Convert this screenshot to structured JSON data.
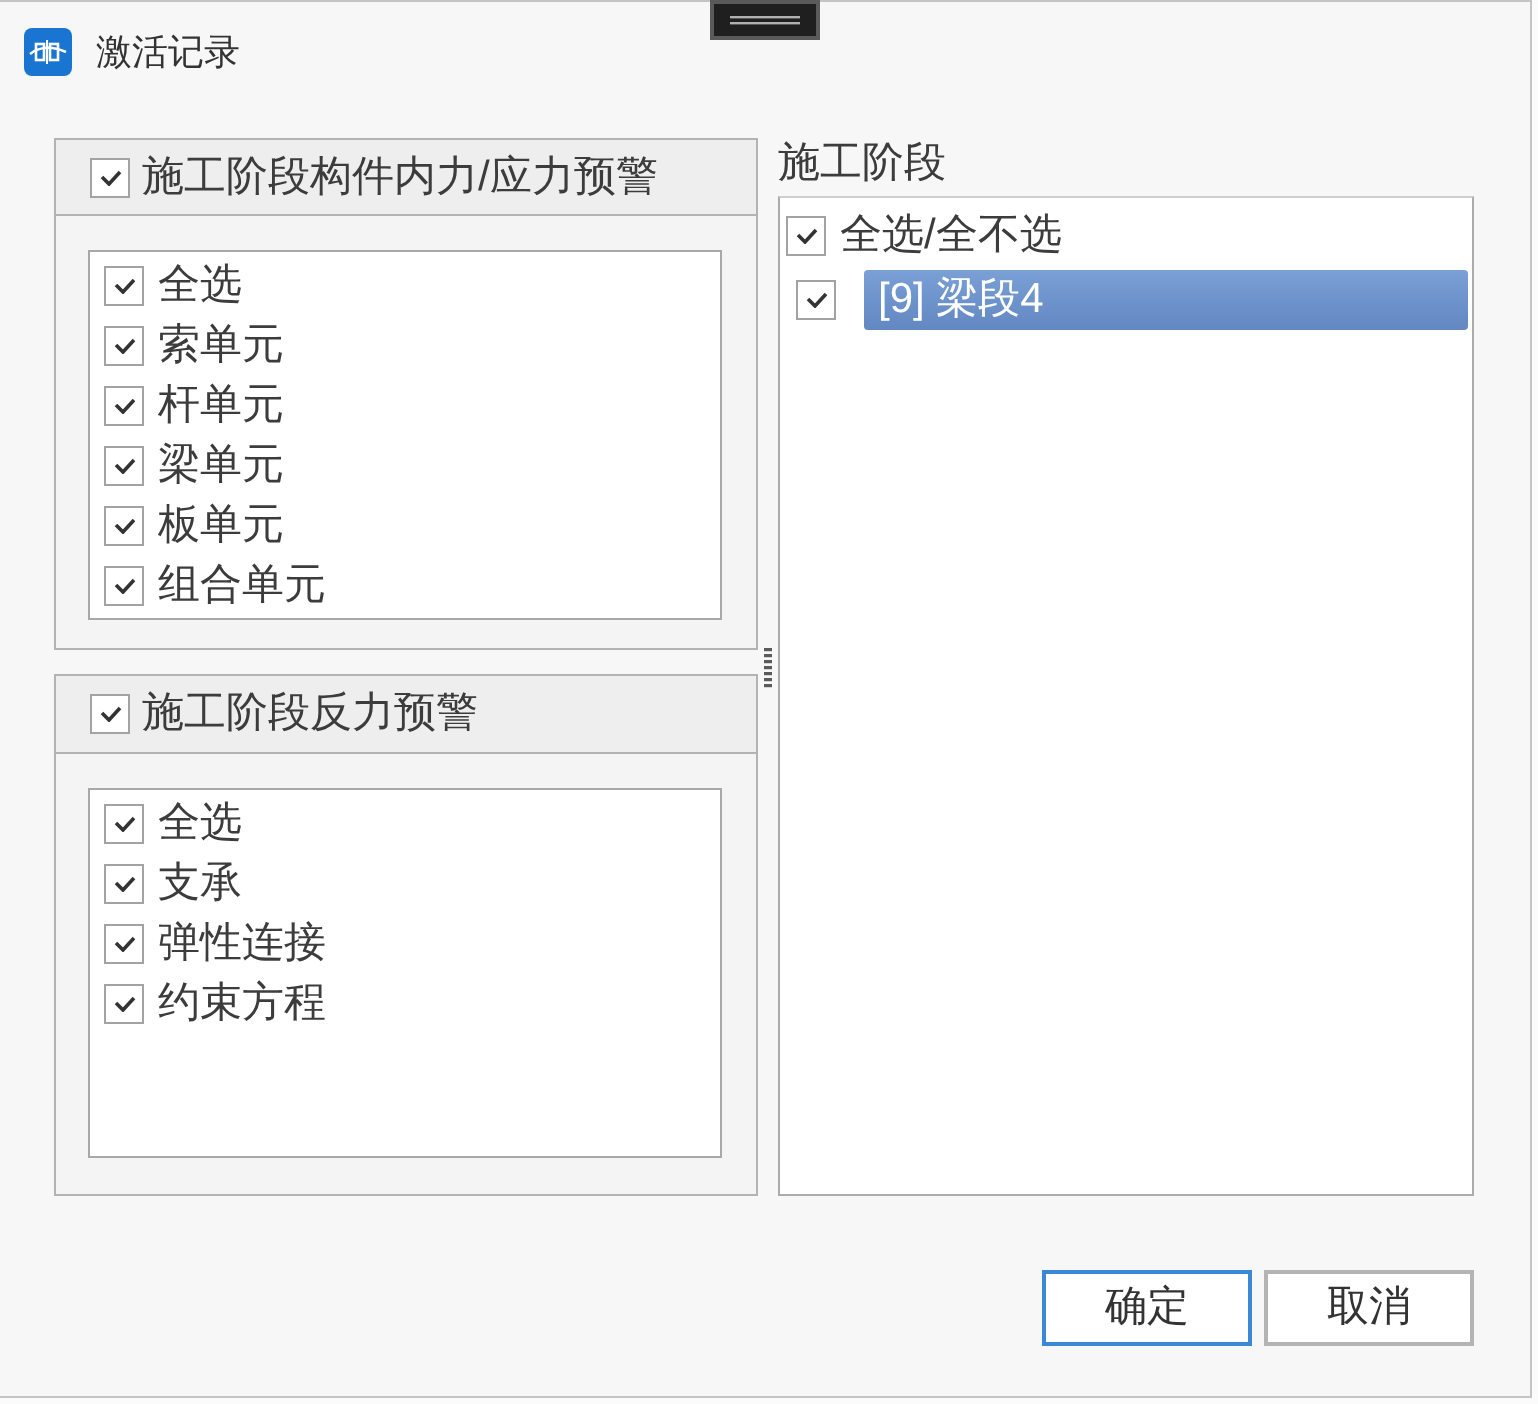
{
  "window": {
    "title": "激活记录"
  },
  "warning_groups": [
    {
      "title": "施工阶段构件内力/应力预警",
      "checked": true,
      "items": [
        {
          "label": "全选",
          "checked": true
        },
        {
          "label": "索单元",
          "checked": true
        },
        {
          "label": "杆单元",
          "checked": true
        },
        {
          "label": "梁单元",
          "checked": true
        },
        {
          "label": "板单元",
          "checked": true
        },
        {
          "label": "组合单元",
          "checked": true
        }
      ]
    },
    {
      "title": "施工阶段反力预警",
      "checked": true,
      "items": [
        {
          "label": "全选",
          "checked": true
        },
        {
          "label": "支承",
          "checked": true
        },
        {
          "label": "弹性连接",
          "checked": true
        },
        {
          "label": "约束方程",
          "checked": true
        }
      ]
    }
  ],
  "stage_panel": {
    "label": "施工阶段",
    "tree": [
      {
        "label": "全选/全不选",
        "checked": true,
        "selected": false,
        "children": [
          {
            "label": "[9] 梁段4",
            "checked": true,
            "selected": true
          }
        ]
      }
    ]
  },
  "buttons": [
    {
      "label": "确定",
      "default": true
    },
    {
      "label": "取消",
      "default": false
    }
  ]
}
